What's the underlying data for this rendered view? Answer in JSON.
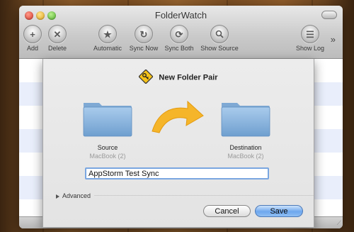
{
  "window": {
    "title": "FolderWatch"
  },
  "toolbar": {
    "add": "Add",
    "delete": "Delete",
    "automatic": "Automatic",
    "sync_now": "Sync Now",
    "sync_both": "Sync Both",
    "show_source": "Show Source",
    "show_log": "Show Log"
  },
  "sheet": {
    "title": "New Folder Pair",
    "source": {
      "label": "Source",
      "sub": "MacBook (2)"
    },
    "destination": {
      "label": "Destination",
      "sub": "MacBook (2)"
    },
    "name_value": "AppStorm Test Sync",
    "advanced_label": "Advanced",
    "cancel_label": "Cancel",
    "save_label": "Save"
  },
  "colors": {
    "accent": "#6ea7ee",
    "arrow": "#f5b52a",
    "folder": "#8db6de"
  }
}
